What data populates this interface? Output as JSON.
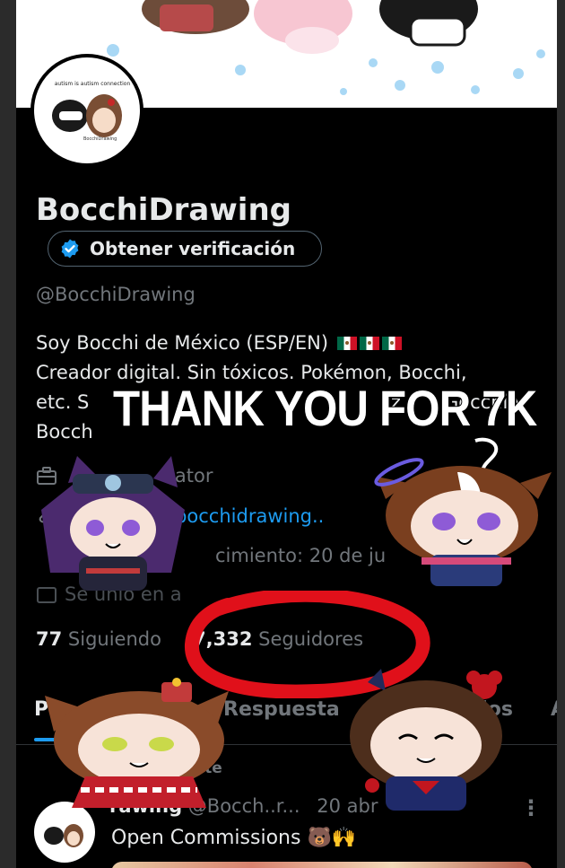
{
  "profile": {
    "display_name": "BocchiDrawing",
    "verify_button_label": "Obtener verificación",
    "handle": "@BocchiDrawing",
    "avatar_caption": "autism is autism connection",
    "avatar_signature": "BocchiDrawing"
  },
  "bio": {
    "line1": "Soy  Bocchi de México  (ESP/EN)",
    "line2": "Creador digital.  Sin tóxicos.   Pokémon, Bocchi,",
    "line3_left": "etc.  S",
    "line3_mid": "iz",
    "line3_right": " Gocchi y",
    "line4_left": "Bocch"
  },
  "meta": {
    "category": "eator",
    "link": "/@bocchidrawing..",
    "birthday": "cimiento: 20 de ju",
    "joined": "Se unió en a"
  },
  "stats": {
    "following_count": "77",
    "following_label": "Siguiendo",
    "followers_count": "7,332",
    "followers_label": "Seguidores"
  },
  "tabs": {
    "posts": "Po",
    "replies": "Respuesta",
    "highlights": "dos",
    "more": "A"
  },
  "post": {
    "pinned_label": "ste",
    "author_name": "rawing",
    "author_handle": "@Bocch..r...",
    "date": "20 abr",
    "text": "Open Commissions 🐻🙌"
  },
  "overlay": {
    "headline": "THANK YOU FOR 7K"
  },
  "colors": {
    "background": "#000000",
    "text_primary": "#e7e9ea",
    "text_secondary": "#71767b",
    "accent_blue": "#1d9bf0",
    "circle_red": "#e0101a"
  }
}
